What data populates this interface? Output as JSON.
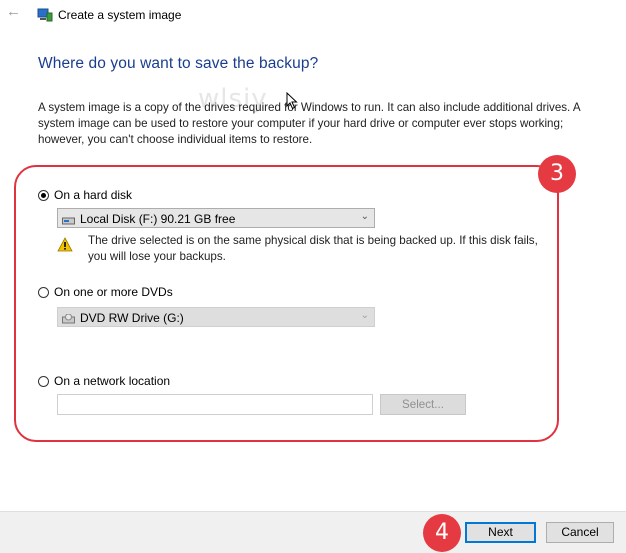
{
  "window": {
    "title": "Create a system image",
    "back_icon": "back-arrow-icon",
    "app_icon": "system-image-icon"
  },
  "page": {
    "heading": "Where do you want to save the backup?",
    "description": "A system image is a copy of the drives required for Windows to run. It can also include additional drives. A system image can be used to restore your computer if your hard drive or computer ever stops working; however, you can't choose individual items to restore."
  },
  "watermark": "wlsiy",
  "options": {
    "hard_disk": {
      "label": "On a hard disk",
      "selected": true,
      "dropdown_value": "Local Disk (F:)  90.21 GB free",
      "warning": "The drive selected is on the same physical disk that is being backed up. If this disk fails, you will lose your backups."
    },
    "dvd": {
      "label": "On one or more DVDs",
      "selected": false,
      "dropdown_value": "DVD RW Drive (G:)",
      "disabled": true
    },
    "network": {
      "label": "On a network location",
      "selected": false,
      "input_value": "",
      "select_label": "Select..."
    }
  },
  "annotations": {
    "step3": "3",
    "step4": "4",
    "color": "#e63a43"
  },
  "footer": {
    "next_label": "Next",
    "cancel_label": "Cancel"
  },
  "colors": {
    "heading": "#1a3d8f",
    "accent": "#0078d7",
    "warning": "#f2c200"
  }
}
